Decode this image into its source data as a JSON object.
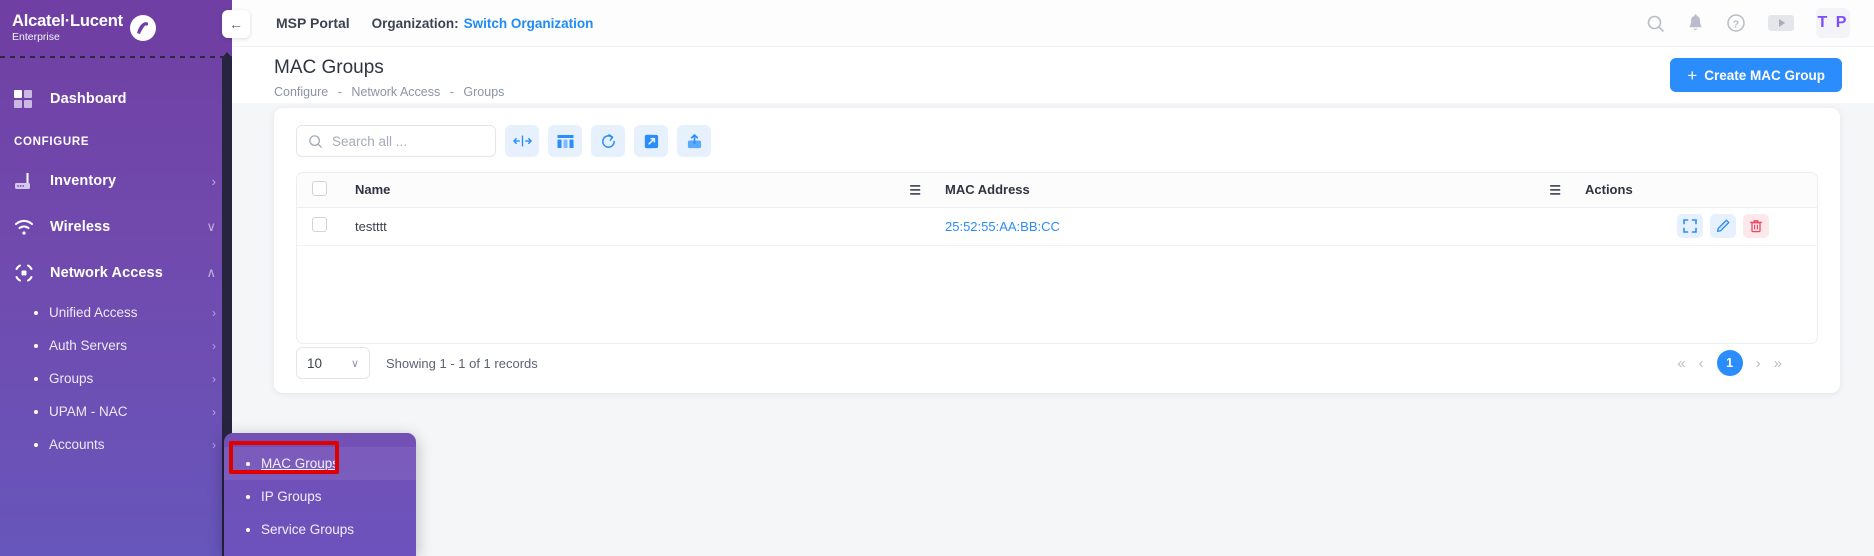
{
  "brand": {
    "name": "Alcatel·Lucent",
    "sub": "Enterprise",
    "logo_icon": "alcatel-lucent-logo-icon"
  },
  "topbar": {
    "collapse_icon": "collapse-sidebar-icon",
    "portal_title": "MSP Portal",
    "organization_label": "Organization:",
    "organization_link": "Switch Organization",
    "icons": [
      "search-icon",
      "bell-icon",
      "help-icon",
      "video-icon"
    ],
    "avatar_initials": "T P"
  },
  "sidebar": {
    "dashboard": {
      "label": "Dashboard",
      "icon": "dashboard-grid-icon"
    },
    "section_label": "CONFIGURE",
    "items": [
      {
        "label": "Inventory",
        "icon": "inventory-router-icon",
        "caret": "›",
        "expanded": false
      },
      {
        "label": "Wireless",
        "icon": "wireless-wifi-icon",
        "caret": "∨",
        "expanded": false
      },
      {
        "label": "Network Access",
        "icon": "network-access-icon",
        "caret": "∧",
        "expanded": true
      }
    ],
    "sub_items": [
      {
        "label": "Unified Access",
        "caret": "›"
      },
      {
        "label": "Auth Servers",
        "caret": "›"
      },
      {
        "label": "Groups",
        "caret": "›"
      },
      {
        "label": "UPAM - NAC",
        "caret": "›"
      },
      {
        "label": "Accounts",
        "caret": "›"
      }
    ]
  },
  "flyout": {
    "items": [
      {
        "label": "MAC Groups",
        "active": true
      },
      {
        "label": "IP Groups",
        "active": false
      },
      {
        "label": "Service Groups",
        "active": false
      }
    ],
    "highlight_color": "#e00000"
  },
  "page": {
    "title": "MAC Groups",
    "breadcrumb": [
      "Configure",
      "Network Access",
      "Groups"
    ],
    "breadcrumb_separator": "-",
    "create_button": "Create MAC Group",
    "create_button_plus": "+",
    "accent_color": "#2b8cfb"
  },
  "toolbar": {
    "search_placeholder": "Search all ...",
    "search_value": "",
    "search_icon": "search-icon",
    "buttons": [
      {
        "icon": "fit-columns-icon",
        "title": "Fit columns"
      },
      {
        "icon": "column-settings-icon",
        "title": "Columns"
      },
      {
        "icon": "refresh-icon",
        "title": "Refresh"
      },
      {
        "icon": "export-icon",
        "title": "Export"
      },
      {
        "icon": "import-upload-icon",
        "title": "Import"
      }
    ]
  },
  "table": {
    "columns": [
      {
        "key": "check",
        "label": ""
      },
      {
        "key": "name",
        "label": "Name",
        "menu_icon": "column-menu-icon"
      },
      {
        "key": "mac",
        "label": "MAC Address",
        "menu_icon": "column-menu-icon"
      },
      {
        "key": "actions",
        "label": "Actions"
      }
    ],
    "rows": [
      {
        "name": "testttt",
        "mac": "25:52:55:AA:BB:CC"
      }
    ],
    "row_actions": [
      {
        "icon": "expand-icon",
        "style": "blue"
      },
      {
        "icon": "edit-pencil-icon",
        "style": "blue"
      },
      {
        "icon": "delete-trash-icon",
        "style": "red"
      }
    ]
  },
  "pagination": {
    "page_size": "10",
    "page_size_caret": "∨",
    "showing_text": "Showing 1 - 1 of 1 records",
    "first": "«",
    "prev": "‹",
    "current_page": "1",
    "next": "›",
    "last": "»"
  }
}
